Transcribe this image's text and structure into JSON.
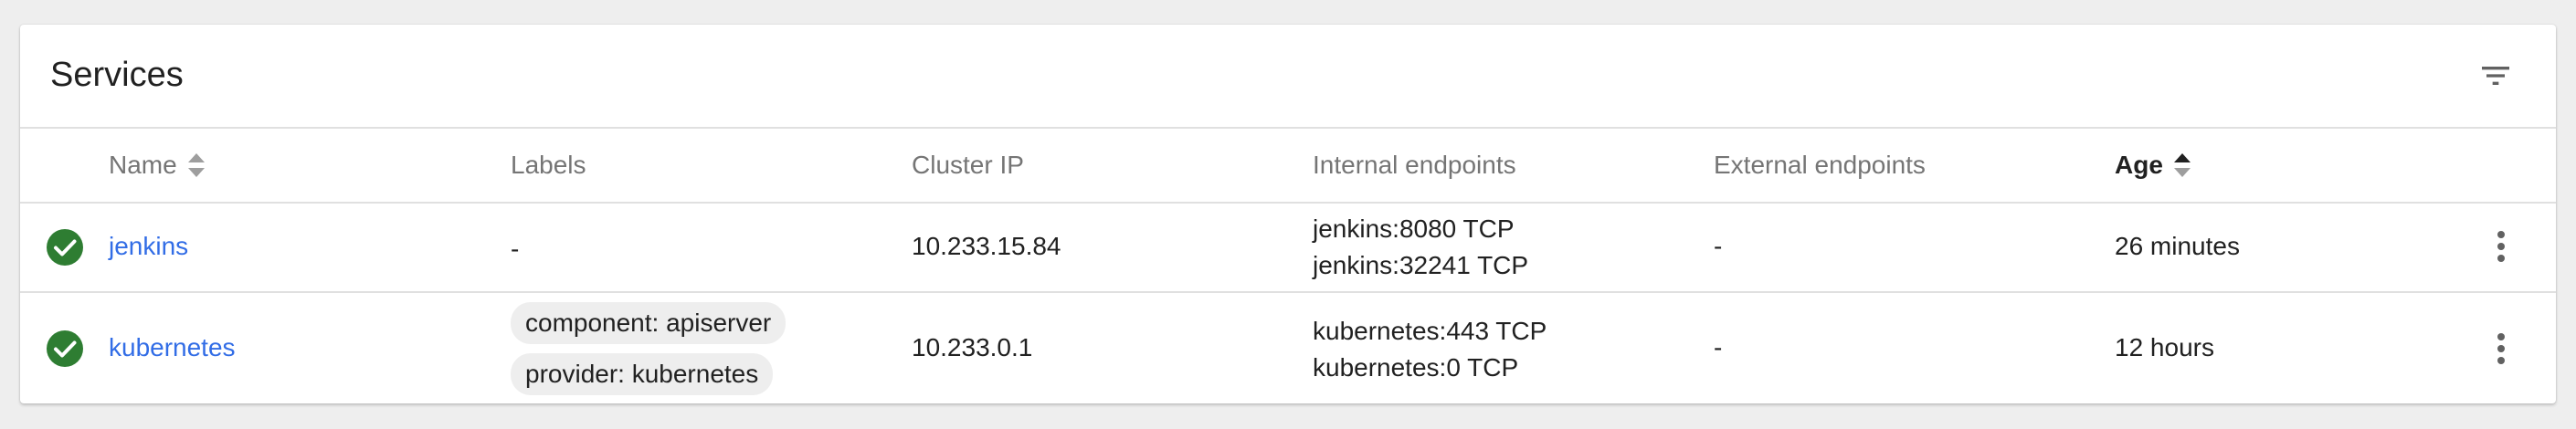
{
  "card": {
    "title": "Services"
  },
  "columns": {
    "name": "Name",
    "labels": "Labels",
    "cluster_ip": "Cluster IP",
    "internal_endpoints": "Internal endpoints",
    "external_endpoints": "External endpoints",
    "age": "Age"
  },
  "rows": [
    {
      "status": "ok",
      "name": "jenkins",
      "labels_text": "-",
      "cluster_ip": "10.233.15.84",
      "internal_endpoints": [
        "jenkins:8080 TCP",
        "jenkins:32241 TCP"
      ],
      "external_endpoints": "-",
      "age": "26 minutes"
    },
    {
      "status": "ok",
      "name": "kubernetes",
      "labels": [
        "component: apiserver",
        "provider: kubernetes"
      ],
      "cluster_ip": "10.233.0.1",
      "internal_endpoints": [
        "kubernetes:443 TCP",
        "kubernetes:0 TCP"
      ],
      "external_endpoints": "-",
      "age": "12 hours"
    }
  ],
  "colors": {
    "link": "#326de6",
    "status_ok": "#2e7d32",
    "chip_bg": "#eeeeee",
    "page_bg": "#eeeeee"
  },
  "icons": {
    "filter": "filter-list-icon",
    "sort": "sort-arrows-icon",
    "status": "check-circle-icon",
    "menu": "more-vert-icon"
  }
}
